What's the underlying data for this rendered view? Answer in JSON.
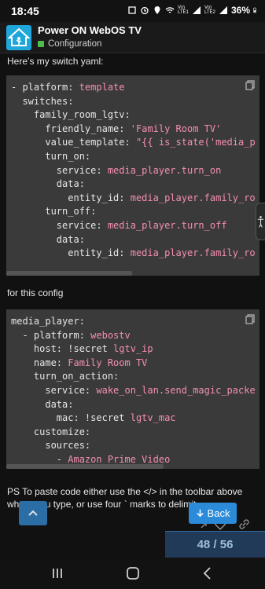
{
  "status": {
    "time": "18:45",
    "network1": "Vo) LTE1",
    "network2": "Vo) LTE2",
    "battery": "36%"
  },
  "header": {
    "title": "Power ON WebOS TV",
    "category": "Configuration",
    "category_color": "#4cbf4c",
    "logo_color": "#1fa7dc"
  },
  "post": {
    "intro": "Here’s my switch yaml:",
    "middle": "for this config",
    "outro": "PS To paste code either use the </> in the toolbar above where you type, or use four ` marks to delimit."
  },
  "code1": [
    {
      "key": "- platform: ",
      "val": "template"
    },
    {
      "key": "  switches:",
      "val": ""
    },
    {
      "key": "    family_room_lgtv:",
      "val": ""
    },
    {
      "key": "      friendly_name: ",
      "val": "'Family Room TV'"
    },
    {
      "key": "      value_template: ",
      "val": "\"{{ is_state('media_p"
    },
    {
      "key": "      turn_on:",
      "val": ""
    },
    {
      "key": "        service: ",
      "val": "media_player.turn_on"
    },
    {
      "key": "        data:",
      "val": ""
    },
    {
      "key": "          entity_id: ",
      "val": "media_player.family_ro"
    },
    {
      "key": "      turn_off:",
      "val": ""
    },
    {
      "key": "        service: ",
      "val": "media_player.turn_off"
    },
    {
      "key": "        data:",
      "val": ""
    },
    {
      "key": "          entity_id: ",
      "val": "media_player.family_ro"
    }
  ],
  "code2": [
    {
      "key": "media_player:",
      "val": ""
    },
    {
      "key": "  - platform: ",
      "val": "webostv"
    },
    {
      "key": "    host: !secret ",
      "val": "lgtv_ip"
    },
    {
      "key": "    name: ",
      "val": "Family Room TV"
    },
    {
      "key": "    turn_on_action:",
      "val": ""
    },
    {
      "key": "      service: ",
      "val": "wake_on_lan.send_magic_packe"
    },
    {
      "key": "      data:",
      "val": ""
    },
    {
      "key": "        mac: !secret ",
      "val": "lgtv_mac"
    },
    {
      "key": "    customize:",
      "val": ""
    },
    {
      "key": "      sources:",
      "val": ""
    },
    {
      "key": "        - ",
      "val": "Amazon Prime Video"
    }
  ],
  "controls": {
    "back_label": "Back",
    "progress": "48 / 56"
  }
}
